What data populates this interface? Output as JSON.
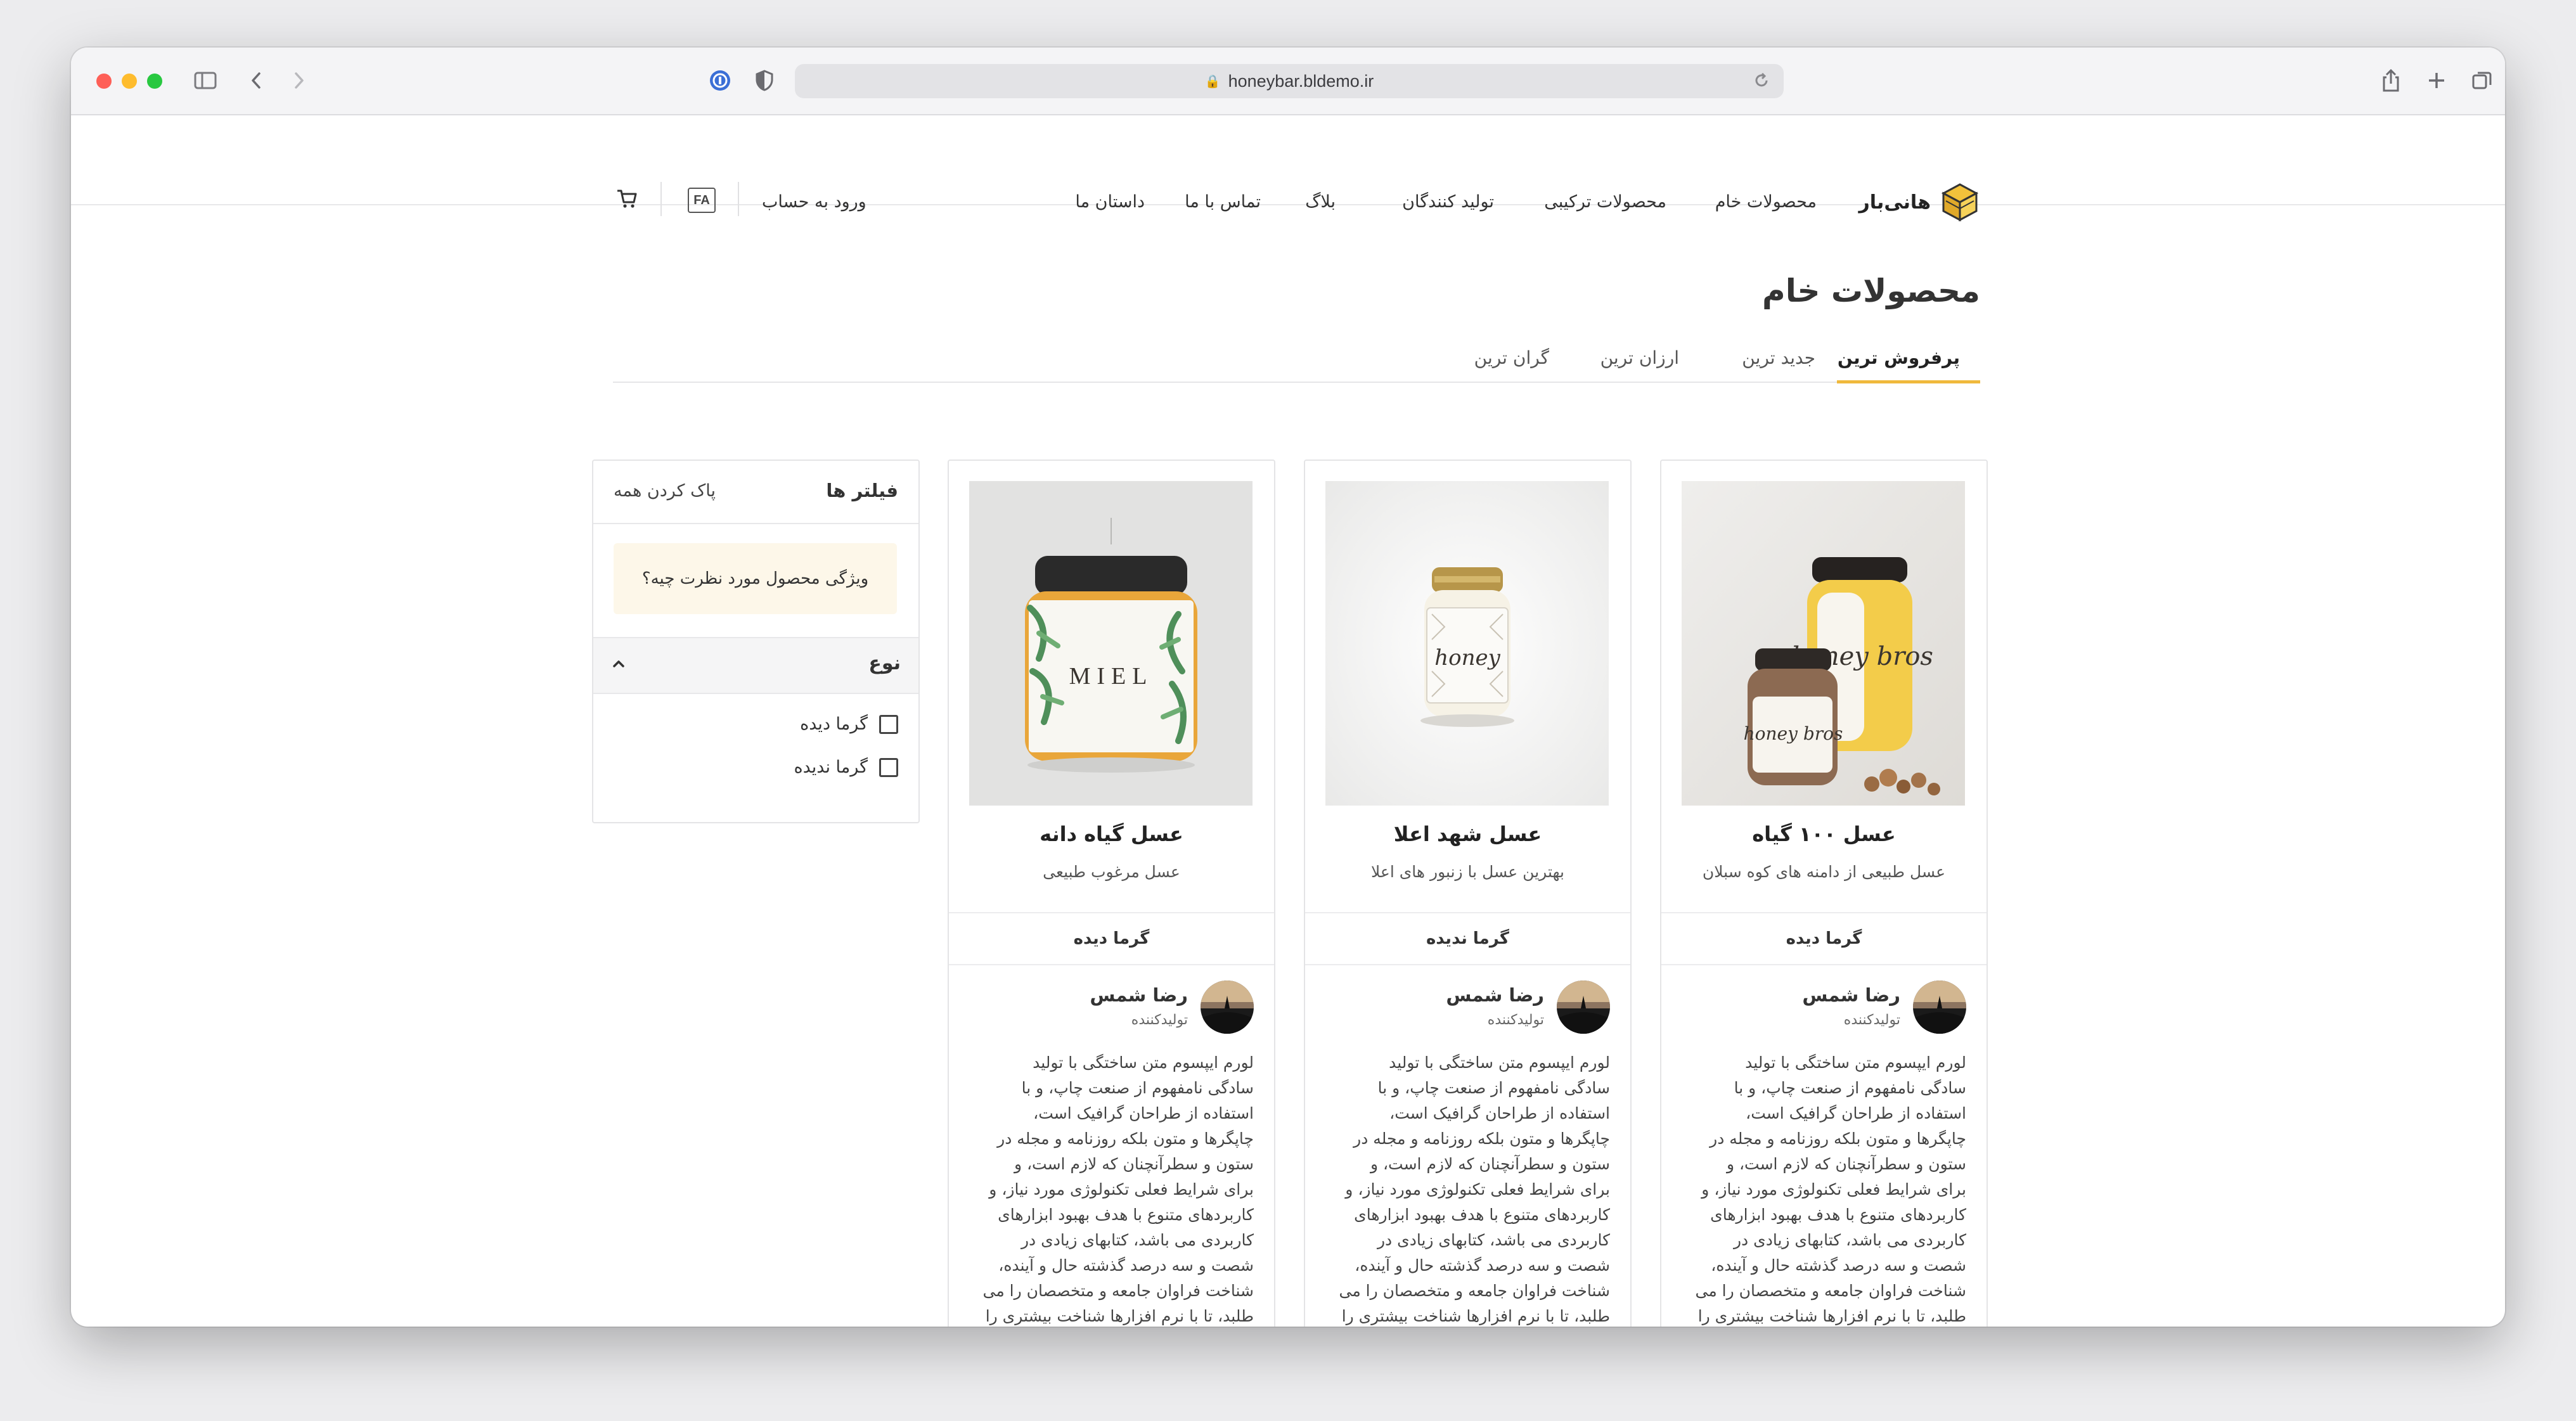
{
  "browser": {
    "url": "honeybar.bldemo.ir"
  },
  "header": {
    "logo_text": "هانی‌بار",
    "nav": [
      "محصولات خام",
      "محصولات ترکیبی",
      "تولید کنندگان",
      "بلاگ",
      "تماس با ما",
      "داستان ما"
    ],
    "login": "ورود به حساب",
    "lang": "FA"
  },
  "page": {
    "title": "محصولات خام",
    "tabs": [
      "پرفروش ترین",
      "جدید ترین",
      "ارزان ترین",
      "گران ترین"
    ],
    "active_tab": "پرفروش ترین"
  },
  "filters": {
    "title": "فیلتر ها",
    "clear_all": "پاک کردن همه",
    "feature_prompt": "ویژگی محصول مورد نظرت چیه؟",
    "type_title": "نوع",
    "options": [
      "گرما دیده",
      "گرما ندیده"
    ]
  },
  "products": [
    {
      "name": "عسل ۱۰۰ گیاه",
      "desc": "عسل طبیعی از دامنه های کوه سبلان",
      "heat": "گرما دیده",
      "producer": "رضا شمس",
      "producer_role": "تولیدکننده",
      "lorem": "لورم ایپسوم متن ساختگی با تولید\nسادگی نامفهوم از صنعت چاپ، و با\nاستفاده از طراحان گرافیک است،\nچاپگرها و متون بلکه روزنامه و مجله در\nستون و سطرآنچنان که لازم است، و\nبرای شرایط فعلی تکنولوژی مورد نیاز، و\nکاربردهای متنوع با هدف بهبود ابزارهای\nکاربردی می باشد، کتابهای زیادی در\nشصت و سه درصد گذشته حال و آینده،\nشناخت فراوان جامعه و متخصصان را می\nطلبد، تا با نرم افزارها شناخت بیشتری را"
    },
    {
      "name": "عسل شهد اعلا",
      "desc": "بهترین عسل با زنبور های اعلا",
      "heat": "گرما ندیده",
      "producer": "رضا شمس",
      "producer_role": "تولیدکننده",
      "lorem": "لورم ایپسوم متن ساختگی با تولید\nسادگی نامفهوم از صنعت چاپ، و با\nاستفاده از طراحان گرافیک است،\nچاپگرها و متون بلکه روزنامه و مجله در\nستون و سطرآنچنان که لازم است، و\nبرای شرایط فعلی تکنولوژی مورد نیاز، و\nکاربردهای متنوع با هدف بهبود ابزارهای\nکاربردی می باشد، کتابهای زیادی در\nشصت و سه درصد گذشته حال و آینده،\nشناخت فراوان جامعه و متخصصان را می\nطلبد، تا با نرم افزارها شناخت بیشتری را"
    },
    {
      "name": "عسل گیاه دانه",
      "desc": "عسل مرغوب طبیعی",
      "heat": "گرما دیده",
      "producer": "رضا شمس",
      "producer_role": "تولیدکننده",
      "lorem": "لورم ایپسوم متن ساختگی با تولید\nسادگی نامفهوم از صنعت چاپ، و با\nاستفاده از طراحان گرافیک است،\nچاپگرها و متون بلکه روزنامه و مجله در\nستون و سطرآنچنان که لازم است، و\nبرای شرایط فعلی تکنولوژی مورد نیاز، و\nکاربردهای متنوع با هدف بهبود ابزارهای\nکاربردی می باشد، کتابهای زیادی در\nشصت و سه درصد گذشته حال و آینده،\nشناخت فراوان جامعه و متخصصان را می\nطلبد، تا با نرم افزارها شناخت بیشتری را"
    }
  ],
  "jar_labels": {
    "p1_large": "honey bros",
    "p1_small": "honey bros",
    "p2": "honey",
    "p3": "MIEL"
  },
  "colors": {
    "accent": "#f0b93c",
    "feature_bg": "#fdf7e9"
  }
}
